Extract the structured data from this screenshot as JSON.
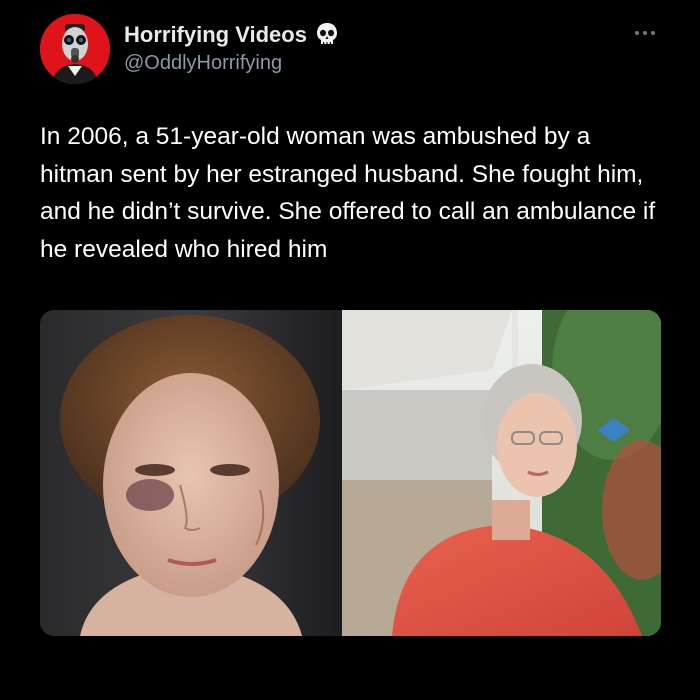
{
  "account": {
    "display_name": "Horrifying Videos",
    "handle": "@OddlyHorrifying",
    "verified_emoji_icon": "skull-icon",
    "avatar_icon": "gasmask-figure-icon",
    "avatar_bg": "#e0121a"
  },
  "post": {
    "text": "In 2006, a 51-year-old woman was ambushed by a hitman sent by her estranged husband. She fought him, and he didn’t survive. She offered to call an ambulance if he revealed who hired him"
  },
  "media": {
    "photos": [
      {
        "name": "injured-woman-photo"
      },
      {
        "name": "woman-on-porch-photo"
      }
    ]
  },
  "colors": {
    "background": "#000000",
    "text": "#ffffff",
    "secondary_text": "#8b98a5"
  }
}
